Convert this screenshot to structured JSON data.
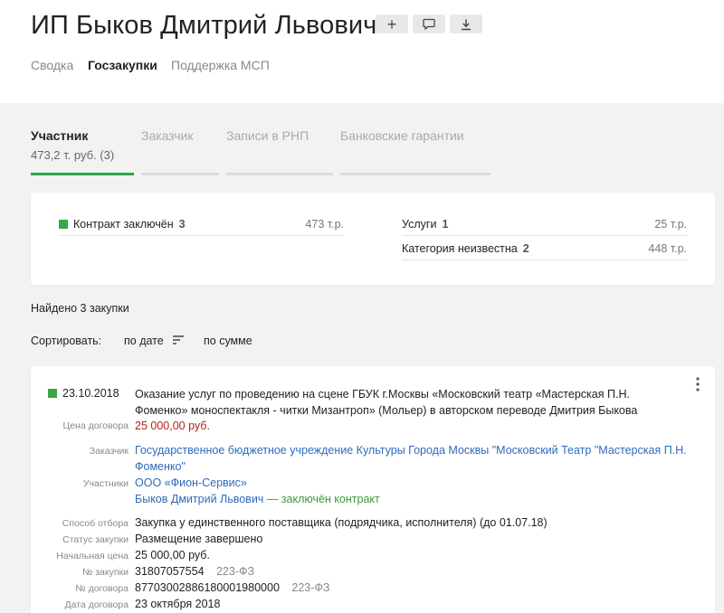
{
  "header": {
    "title": "ИП Быков Дмитрий Львович",
    "buttons": {
      "add": "+",
      "comment_icon": "comment-icon",
      "download_icon": "download-icon"
    },
    "nav": [
      "Сводка",
      "Госзакупки",
      "Поддержка МСП"
    ]
  },
  "tabs": {
    "items": [
      "Участник",
      "Заказчик",
      "Записи в РНП",
      "Банковские гарантии"
    ],
    "active_sub": "473,2 т. руб. (3)"
  },
  "summary": {
    "left": {
      "label": "Контракт заключён",
      "count": "3",
      "amount": "473 т.р."
    },
    "right": [
      {
        "label": "Услуги",
        "count": "1",
        "amount": "25 т.р."
      },
      {
        "label": "Категория неизвестна",
        "count": "2",
        "amount": "448 т.р."
      }
    ]
  },
  "found": "Найдено 3 закупки",
  "sort": {
    "label": "Сортировать:",
    "by_date": "по дате",
    "by_sum": "по сумме"
  },
  "procurement": {
    "date": "23.10.2018",
    "title_line1": "Оказание услуг по проведению на сцене ГБУК г.Москвы «Московский театр «Мастерская П.Н.",
    "title_line2": "Фоменко» моноспектакля - читки Мизантроп» (Мольер) в авторском переводе Дмитрия Быкова",
    "price_label": "Цена договора",
    "price": "25 000,00 руб.",
    "customer_label": "Заказчик",
    "customer_line1": "Государственное бюджетное учреждение Культуры Города Москвы \"Московский Театр \"Мастерская П.Н.",
    "customer_line2": "Фоменко\"",
    "participants_label": "Участники",
    "participant1": "ООО «Фион-Сервис»",
    "participant2": "Быков Дмитрий Львович",
    "participant2_status": "— заключён контракт",
    "method_label": "Способ отбора",
    "method": "Закупка у единственного поставщика (подрядчика, исполнителя) (до 01.07.18)",
    "status_label": "Статус закупки",
    "status": "Размещение завершено",
    "start_price_label": "Начальная цена",
    "start_price": "25 000,00 руб.",
    "number_label": "№ закупки",
    "number": "31807057554",
    "number_law": "223-ФЗ",
    "contract_no_label": "№ договора",
    "contract_no": "87703002886180001980000",
    "contract_law": "223-ФЗ",
    "contract_date_label": "Дата договора",
    "contract_date": "23 октября 2018"
  },
  "colors": {
    "accent": "#2fa44f",
    "link": "#2e6bbd",
    "price": "#b3221d",
    "status_green": "#3a9a36"
  }
}
